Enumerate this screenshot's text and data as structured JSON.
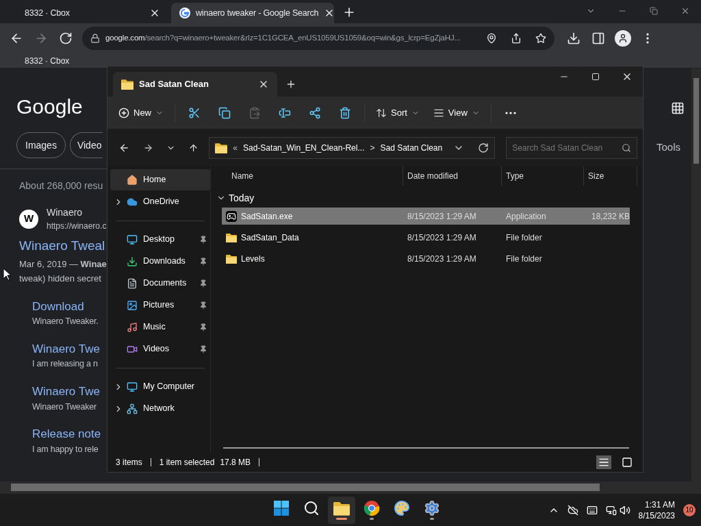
{
  "browser": {
    "tabs": [
      {
        "title": "8332 · Cbox",
        "selected": false
      },
      {
        "title": "winaero tweaker - Google Search",
        "selected": true
      }
    ],
    "address": {
      "host": "google.com",
      "path": "/search?q=winaero+tweaker&rlz=1C1GCEA_enUS1059US1059&oq=win&gs_lcrp=EgZjaHJ..."
    },
    "bookmarks": [
      "8332 · Cbox"
    ]
  },
  "google": {
    "logo": "Google",
    "chips": [
      "Images",
      "Video"
    ],
    "tools": "Tools",
    "result_count": "About 268,000 resu",
    "result": {
      "favicon": "W",
      "site": "Winaero",
      "url": "https://winaero.c",
      "title": "Winaero Tweal",
      "snippet": [
        "Mar 6, 2019 — **Winae**",
        "tweak) hidden secret"
      ]
    },
    "sublinks": [
      {
        "title": "Download",
        "text": "Winaero Tweaker."
      },
      {
        "title": "Winaero Twe",
        "text": "I am releasing a n"
      },
      {
        "title": "Winaero Twe",
        "text": "Winaero Tweaker"
      },
      {
        "title": "Release note",
        "text": "I am happy to rele"
      }
    ]
  },
  "explorer": {
    "tab": "Sad Satan Clean",
    "toolbar": [
      {
        "kind": "new",
        "label": "New",
        "disabled": false
      },
      {
        "kind": "cut",
        "disabled": false
      },
      {
        "kind": "copy",
        "disabled": false
      },
      {
        "kind": "paste",
        "disabled": true
      },
      {
        "kind": "rename",
        "disabled": false
      },
      {
        "kind": "share",
        "disabled": false
      },
      {
        "kind": "delete",
        "disabled": false
      },
      {
        "kind": "sort",
        "label": "Sort",
        "disabled": false
      },
      {
        "kind": "view",
        "label": "View",
        "disabled": false
      },
      {
        "kind": "more",
        "disabled": false
      }
    ],
    "breadcrumb": {
      "overflow": "«",
      "parts": [
        "Sad-Satan_Win_EN_Clean-Rel...",
        "Sad Satan Clean"
      ],
      "separator": ">"
    },
    "search": {
      "placeholder": "Search Sad Satan Clean"
    },
    "sidebar": {
      "groups": [
        [
          {
            "label": "Home",
            "selected": true,
            "expandable": false,
            "pinned": false
          },
          {
            "label": "OneDrive",
            "selected": false,
            "expandable": true,
            "pinned": false
          }
        ],
        [
          {
            "label": "Desktop",
            "selected": false,
            "expandable": false,
            "pinned": true
          },
          {
            "label": "Downloads",
            "selected": false,
            "expandable": false,
            "pinned": true
          },
          {
            "label": "Documents",
            "selected": false,
            "expandable": false,
            "pinned": true
          },
          {
            "label": "Pictures",
            "selected": false,
            "expandable": false,
            "pinned": true
          },
          {
            "label": "Music",
            "selected": false,
            "expandable": false,
            "pinned": true
          },
          {
            "label": "Videos",
            "selected": false,
            "expandable": false,
            "pinned": true
          }
        ],
        [
          {
            "label": "My Computer",
            "selected": false,
            "expandable": true,
            "pinned": false
          },
          {
            "label": "Network",
            "selected": false,
            "expandable": true,
            "pinned": false
          }
        ]
      ]
    },
    "columns": [
      "Name",
      "Date modified",
      "Type",
      "Size"
    ],
    "group": {
      "label": "Today",
      "expanded": true
    },
    "rows": [
      {
        "kind": "application",
        "name": "SadSatan.exe",
        "date": "8/15/2023 1:29 AM",
        "type": "Application",
        "size": "18,232 KB",
        "selected": true
      },
      {
        "kind": "folder",
        "name": "SadSatan_Data",
        "date": "8/15/2023 1:29 AM",
        "type": "File folder",
        "selected": false
      },
      {
        "kind": "folder",
        "name": "Levels",
        "date": "8/15/2023 1:29 AM",
        "type": "File folder",
        "selected": false
      }
    ],
    "status": {
      "count": "3 items",
      "selection": "1 item selected",
      "size": "17.8 MB"
    },
    "views": [
      {
        "kind": "details",
        "selected": true
      },
      {
        "kind": "tiles",
        "selected": false
      }
    ]
  },
  "taskbar": {
    "apps": [
      {
        "kind": "start",
        "selected": false,
        "running": false
      },
      {
        "kind": "search",
        "selected": false,
        "running": false
      },
      {
        "kind": "explorer",
        "selected": true,
        "running": true
      },
      {
        "kind": "chrome",
        "selected": false,
        "running": true
      },
      {
        "kind": "paint",
        "selected": false,
        "running": false
      },
      {
        "kind": "settings",
        "selected": false,
        "running": true
      }
    ],
    "time": "1:31 AM",
    "date": "8/15/2023",
    "notifications": "10"
  }
}
